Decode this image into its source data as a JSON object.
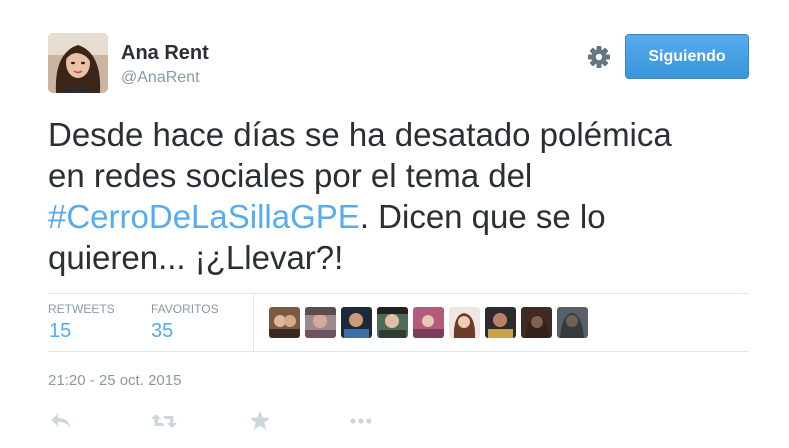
{
  "user": {
    "name": "Ana Rent",
    "handle": "@AnaRent"
  },
  "follow_button": {
    "label": "Siguiendo"
  },
  "tweet": {
    "text_line1": "Desde hace días se ha desatado polémica",
    "text_line2": "en redes sociales por el tema del",
    "hashtag": "#CerroDeLaSillaGPE",
    "text_line3_rest": ". Dicen que se lo",
    "text_line4": "quieren... ¡¿Llevar?!"
  },
  "stats": {
    "retweets_label": "RETWEETS",
    "retweets_count": "15",
    "favorites_label": "FAVORITOS",
    "favorites_count": "35"
  },
  "timestamp": "21:20 - 25 oct. 2015",
  "icons": {
    "settings": "gear-icon",
    "reply": "reply-icon",
    "retweet": "retweet-icon",
    "favorite": "star-icon",
    "more": "more-icon"
  },
  "colors": {
    "accent": "#55acee",
    "text": "#292f33",
    "muted": "#8899a6",
    "button": "#3b94d9"
  }
}
